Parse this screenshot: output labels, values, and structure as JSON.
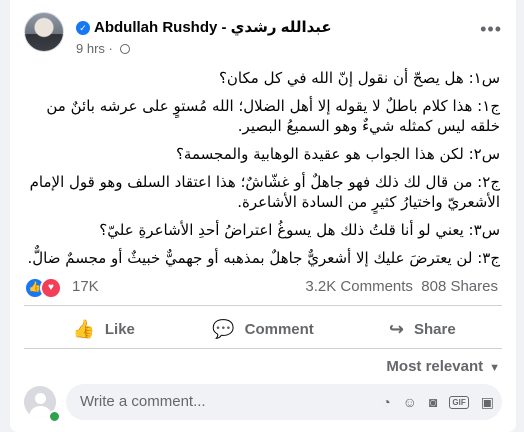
{
  "post": {
    "author_name": "Abdullah Rushdy - عبدالله رشدي",
    "time": "9 hrs",
    "separator": "·",
    "more": "•••",
    "verified_glyph": "✓",
    "paragraphs": [
      "س١: هل يصحّ أن نقول إنّ الله في كل مكان؟",
      "ج١: هذا كلام باطلٌ لا يقوله إلا أهل الضلال؛ الله مُستوٍ على عرشه بائنٌ من خلقه ليس كمثله شيءٌ وهو السميعُ البصير.",
      "س٢: لكن هذا الجواب هو عقيدة الوهابية والمجسمة؟",
      "ج٢: من قال لك ذلك فهو جاهلٌ أو غشّاشٌ؛ هذا اعتقاد السلف وهو قول الإمام الأشعريّ واختيارُ كثيرٍ من السادة الأشاعرة.",
      "س٣: يعني لو أنا قلتُ ذلك هل يسوغُ اعتراضُ أحدِ الأشاعرةِ عليّ؟",
      "ج٣: لن يعترضَ عليك إلا أشعريٌّ جاهلٌ بمذهبه أو جهميٌّ خبيثٌ أو مجسمٌ ضالٌّ."
    ]
  },
  "stats": {
    "reactions": "17K",
    "comments": "3.2K Comments",
    "shares": "808 Shares",
    "like_glyph": "👍",
    "love_glyph": "♥"
  },
  "actions": {
    "like": "Like",
    "comment": "Comment",
    "share": "Share",
    "like_icon": "👍",
    "comment_icon": "💬",
    "share_icon": "↪"
  },
  "sort": {
    "label": "Most relevant",
    "caret": "▼"
  },
  "composer": {
    "placeholder": "Write a comment...",
    "icons": [
      "sticker-icon",
      "emoji-icon",
      "camera-icon",
      "gif-icon",
      "sticker-square-icon"
    ],
    "emoji_glyph": "☺",
    "camera_glyph": "◙",
    "gif_label": "GIF",
    "sticker_glyph": "▣",
    "sticker2_glyph": "◔"
  },
  "colors": {
    "accent": "#1877f2",
    "love": "#f33e58",
    "online": "#31a24c",
    "secondary_text": "#65676b"
  }
}
